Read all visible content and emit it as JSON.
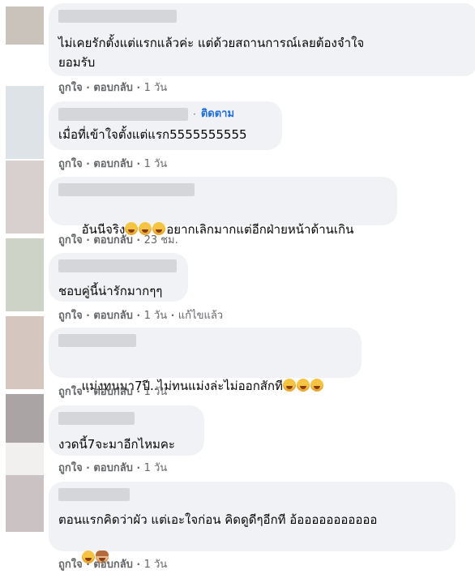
{
  "comments": [
    {
      "text": "ไม่เคยรักตั้งแต่แรกแล้วค่ะ แต่ด้วยสถานการณ์เลยต้องจำใจ\nยอมรับ",
      "like": "ถูกใจ",
      "reply": "ตอบกลับ",
      "time": "1 วัน",
      "avatar_color": "#c9c3bb"
    },
    {
      "text": "เมื่อที่เข้าใจตั้งแต่แรก5555555555",
      "follow": "ติดตาม",
      "like": "ถูกใจ",
      "reply": "ตอบกลับ",
      "time": "1 วัน",
      "avatar_color": "#dde3e6"
    },
    {
      "text": "อันนีจริง",
      "text_after": "อยากเลิกมากแต่อีกฝ่ายหน้าด้านเกิน",
      "like": "ถูกใจ",
      "reply": "ตอบกลับ",
      "time": "23 ชม.",
      "avatar_color": "#d8cfcf"
    },
    {
      "text": "ชอบคู่นี้น่ารักมากๆๆ",
      "like": "ถูกใจ",
      "reply": "ตอบกลับ",
      "time": "1 วัน",
      "edited": "แก้ไขแล้ว",
      "avatar_color": "#cdd3c6"
    },
    {
      "text": "แม่งทนมา7ปี..ไม่ทนแม่งล่ะไม่ออกสักที",
      "like": "ถูกใจ",
      "reply": "ตอบกลับ",
      "time": "1 วัน",
      "avatar_color": "#d6c6c0"
    },
    {
      "text": "งวดนี้7จะมาอีกไหมคะ",
      "like": "ถูกใจ",
      "reply": "ตอบกลับ",
      "time": "1 วัน",
      "avatar_color": "#aaa4a4"
    },
    {
      "text": "ตอนแรกคิดว่าผัว แต่เอะใจก่อน คิดดูดีๆอีกที อ้อออออออออออ",
      "like": "ถูกใจ",
      "reply": "ตอบกลับ",
      "time": "1 วัน",
      "avatar_color": "#cbc2c4"
    }
  ],
  "separator": "·",
  "colors": {
    "bubble": "#f0f2f5",
    "action_text": "#65676b",
    "follow_link": "#216fdb"
  }
}
